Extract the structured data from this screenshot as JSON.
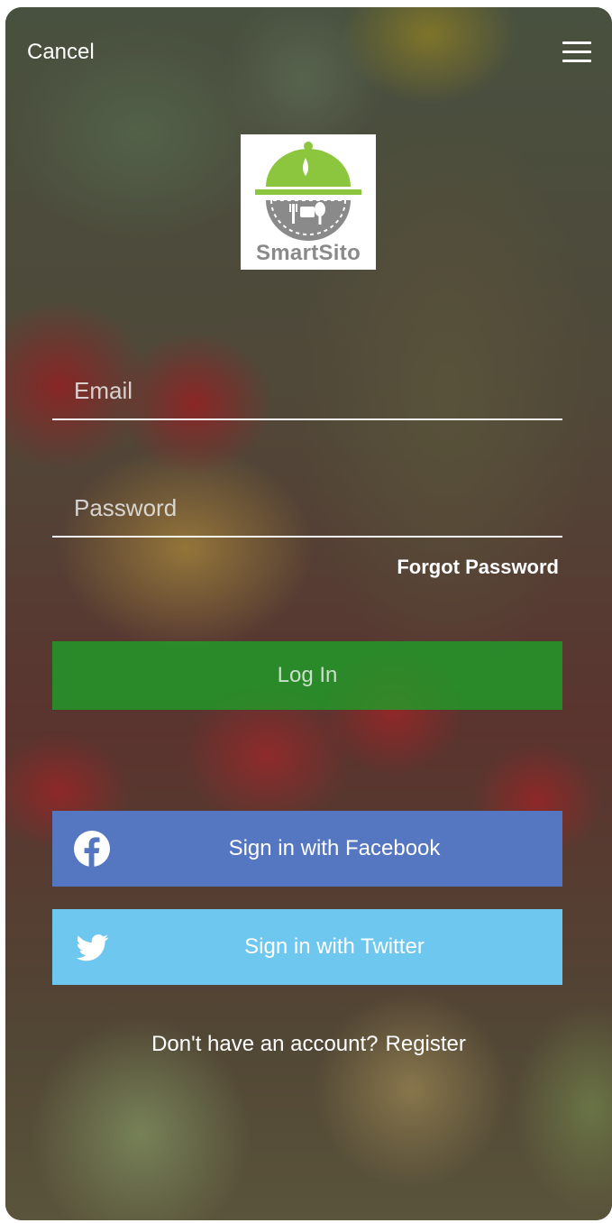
{
  "header": {
    "cancel_label": "Cancel",
    "menu_icon": "hamburger-menu-icon"
  },
  "logo": {
    "text": "SmartSito",
    "icon": "cloche-plate-icon",
    "colors": {
      "green": "#8cc63f",
      "gray": "#8a8a8a"
    }
  },
  "form": {
    "email_placeholder": "Email",
    "email_value": "",
    "password_placeholder": "Password",
    "password_value": "",
    "forgot_label": "Forgot Password",
    "login_label": "Log In"
  },
  "social": {
    "facebook_label": "Sign in with Facebook",
    "facebook_icon": "facebook-icon",
    "twitter_label": "Sign in with Twitter",
    "twitter_icon": "twitter-icon"
  },
  "footer": {
    "question": "Don't have an account?",
    "register_label": "Register"
  },
  "colors": {
    "login_button": "#1ea028",
    "facebook_button": "#5577c2",
    "twitter_button": "#6ec7ef"
  }
}
